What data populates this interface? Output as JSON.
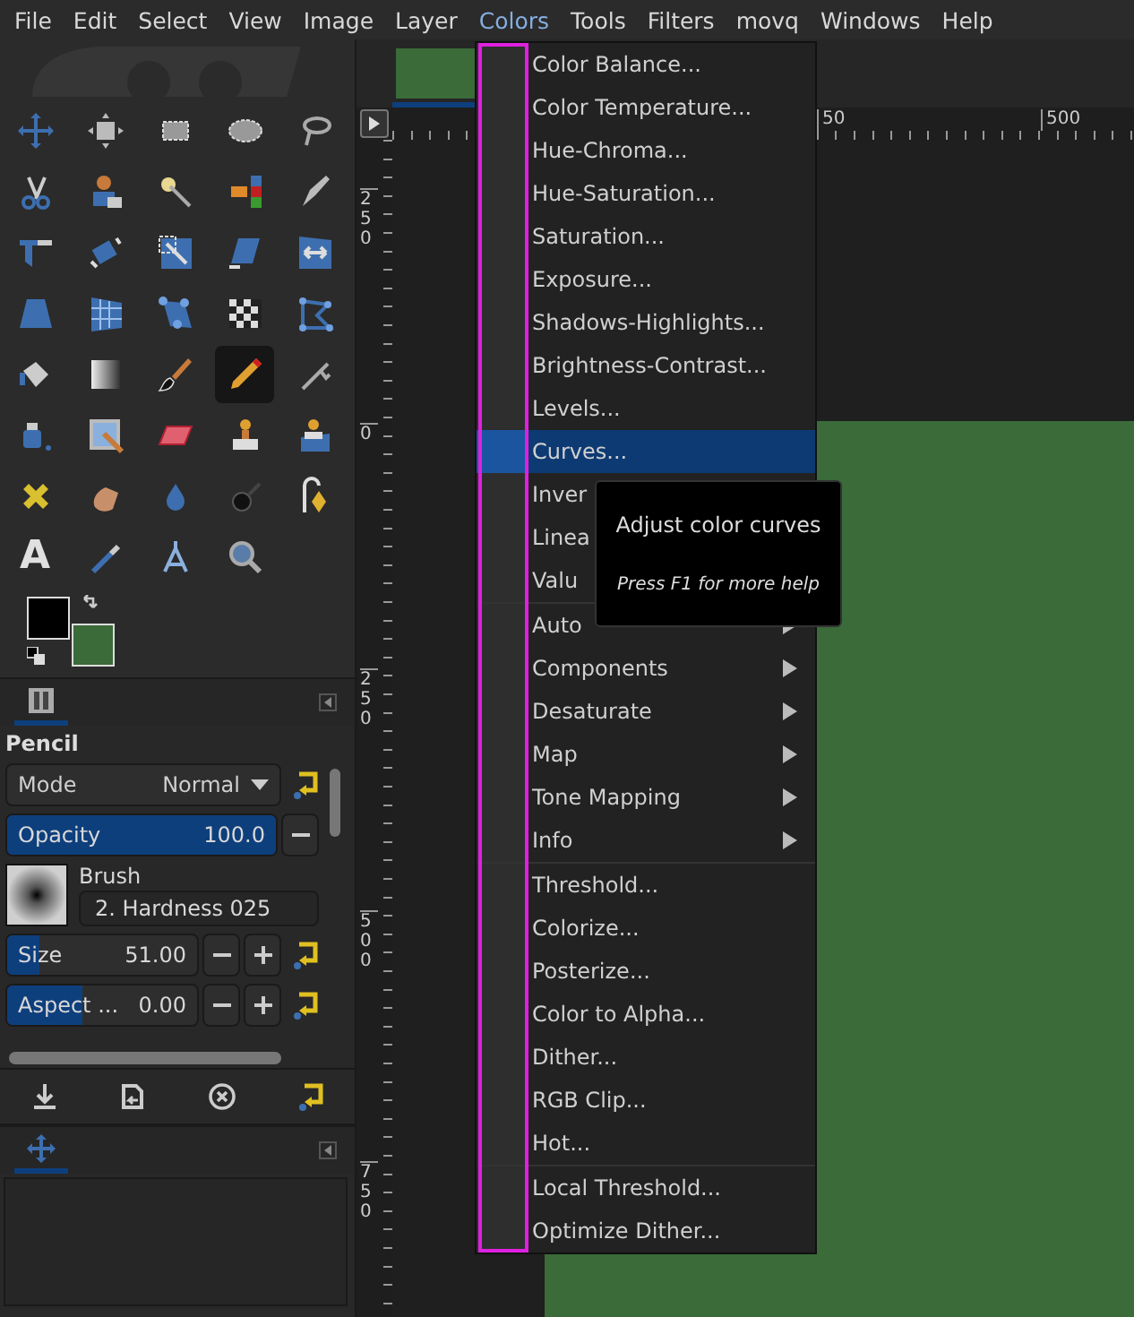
{
  "menubar": [
    {
      "label": "File",
      "selected": false
    },
    {
      "label": "Edit",
      "selected": false
    },
    {
      "label": "Select",
      "selected": false
    },
    {
      "label": "View",
      "selected": false
    },
    {
      "label": "Image",
      "selected": false
    },
    {
      "label": "Layer",
      "selected": false
    },
    {
      "label": "Colors",
      "selected": true
    },
    {
      "label": "Tools",
      "selected": false
    },
    {
      "label": "Filters",
      "selected": false
    },
    {
      "label": "movq",
      "selected": false
    },
    {
      "label": "Windows",
      "selected": false
    },
    {
      "label": "Help",
      "selected": false
    }
  ],
  "toolbox": {
    "tools": [
      {
        "selected": false
      },
      {
        "selected": false
      },
      {
        "selected": false
      },
      {
        "selected": false
      },
      {
        "selected": false
      },
      {
        "selected": false
      },
      {
        "selected": false
      },
      {
        "selected": false
      },
      {
        "selected": false
      },
      {
        "selected": false
      },
      {
        "selected": false
      },
      {
        "selected": false
      },
      {
        "selected": false
      },
      {
        "selected": false
      },
      {
        "selected": false
      },
      {
        "selected": false
      },
      {
        "selected": false
      },
      {
        "selected": false
      },
      {
        "selected": false
      },
      {
        "selected": false
      },
      {
        "selected": false
      },
      {
        "selected": false
      },
      {
        "selected": false
      },
      {
        "selected": true
      },
      {
        "selected": false
      },
      {
        "selected": false
      },
      {
        "selected": false
      },
      {
        "selected": false
      },
      {
        "selected": false
      },
      {
        "selected": false
      },
      {
        "selected": false
      },
      {
        "selected": false
      },
      {
        "selected": false
      },
      {
        "selected": false
      },
      {
        "selected": false
      },
      {
        "selected": false,
        "glyph": "A"
      },
      {
        "selected": false
      },
      {
        "selected": false
      },
      {
        "selected": false
      }
    ],
    "color_swatches": [
      {
        "kind": "foreground",
        "color": "#000000"
      },
      {
        "kind": "background",
        "color": "#3a6b38"
      }
    ]
  },
  "tool_options": {
    "tabs": [
      {
        "selected": true
      }
    ],
    "title": "Pencil",
    "mode": {
      "label": "Mode",
      "value": "Normal"
    },
    "opacity": {
      "label": "Opacity",
      "reading": "100.0",
      "level": 1.0
    },
    "brush": {
      "label": "Brush",
      "value": "2. Hardness 025"
    },
    "size": {
      "label": "Size",
      "reading": "51.00",
      "level": 0.17
    },
    "aspect": {
      "label": "Aspect ...",
      "reading": "0.00",
      "level": 0.4
    }
  },
  "pointer_dock": {
    "tabs": [
      {
        "selected": true
      }
    ]
  },
  "image_tabs": [
    {
      "selected": true
    }
  ],
  "rulers": {
    "horizontal": [
      "50",
      "500"
    ],
    "vertical": [
      "250",
      "0",
      "250",
      "500",
      "750"
    ]
  },
  "colors_menu": {
    "groups": [
      [
        {
          "label": "Color Balance...",
          "kind": "action",
          "selected": false
        },
        {
          "label": "Color Temperature...",
          "kind": "action",
          "selected": false
        },
        {
          "label": "Hue-Chroma...",
          "kind": "action",
          "selected": false
        },
        {
          "label": "Hue-Saturation...",
          "kind": "action",
          "selected": false
        },
        {
          "label": "Saturation...",
          "kind": "action",
          "selected": false
        },
        {
          "label": "Exposure...",
          "kind": "action",
          "selected": false
        },
        {
          "label": "Shadows-Highlights...",
          "kind": "action",
          "selected": false
        },
        {
          "label": "Brightness-Contrast...",
          "kind": "action",
          "selected": false
        },
        {
          "label": "Levels...",
          "kind": "action",
          "selected": false
        },
        {
          "label": "Curves...",
          "kind": "action",
          "selected": true
        },
        {
          "label": "Inver",
          "kind": "action",
          "selected": false
        },
        {
          "label": "Linea",
          "kind": "action",
          "selected": false
        },
        {
          "label": "Valu",
          "kind": "action",
          "selected": false
        }
      ],
      [
        {
          "label": "Auto",
          "kind": "submenu",
          "selected": false
        },
        {
          "label": "Components",
          "kind": "submenu",
          "selected": false
        },
        {
          "label": "Desaturate",
          "kind": "submenu",
          "selected": false
        },
        {
          "label": "Map",
          "kind": "submenu",
          "selected": false
        },
        {
          "label": "Tone Mapping",
          "kind": "submenu",
          "selected": false
        },
        {
          "label": "Info",
          "kind": "submenu",
          "selected": false
        }
      ],
      [
        {
          "label": "Threshold...",
          "kind": "action",
          "selected": false
        },
        {
          "label": "Colorize...",
          "kind": "action",
          "selected": false
        },
        {
          "label": "Posterize...",
          "kind": "action",
          "selected": false
        },
        {
          "label": "Color to Alpha...",
          "kind": "action",
          "selected": false
        },
        {
          "label": "Dither...",
          "kind": "action",
          "selected": false
        },
        {
          "label": "RGB Clip...",
          "kind": "action",
          "selected": false
        },
        {
          "label": "Hot...",
          "kind": "action",
          "selected": false
        }
      ],
      [
        {
          "label": "Local Threshold...",
          "kind": "action",
          "selected": false
        },
        {
          "label": "Optimize Dither...",
          "kind": "action",
          "selected": false
        }
      ]
    ]
  },
  "tooltip": {
    "title": "Adjust color curves",
    "hint": "Press F1 for more help"
  }
}
